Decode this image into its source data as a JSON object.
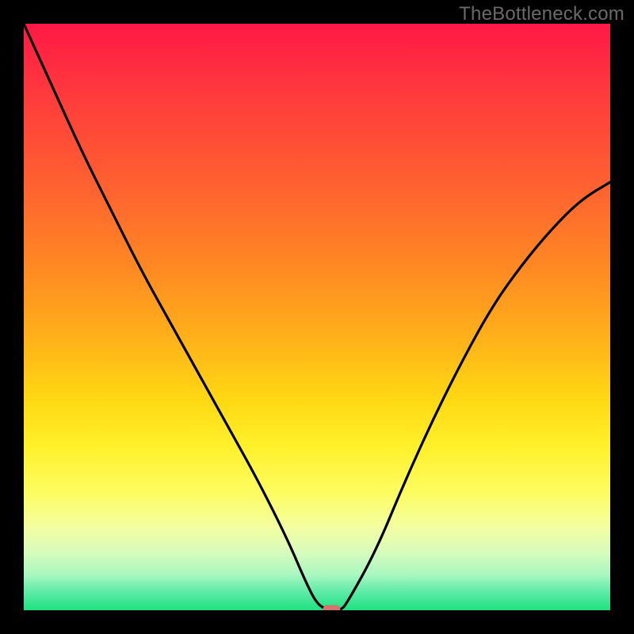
{
  "watermark": "TheBottleneck.com",
  "chart_data": {
    "type": "line",
    "title": "",
    "xlabel": "",
    "ylabel": "",
    "xlim": [
      0,
      100
    ],
    "ylim": [
      0,
      100
    ],
    "grid": false,
    "legend": false,
    "series": [
      {
        "name": "bottleneck-curve",
        "x": [
          0,
          5,
          10,
          15,
          20,
          25,
          30,
          35,
          40,
          45,
          48,
          50,
          52,
          54,
          55,
          60,
          65,
          70,
          75,
          80,
          85,
          90,
          95,
          100
        ],
        "values": [
          100,
          89,
          78,
          68,
          58,
          49,
          40,
          31,
          22,
          12,
          5,
          1,
          0,
          0,
          1,
          10,
          22,
          33,
          43,
          52,
          59,
          65,
          70,
          73
        ]
      }
    ],
    "marker": {
      "x": 52.5,
      "y": 0,
      "color": "#d4756b"
    },
    "background_gradient": {
      "direction": "top-to-bottom",
      "stops": [
        {
          "pos": 0,
          "color": "#ff1846"
        },
        {
          "pos": 12,
          "color": "#ff3a3d"
        },
        {
          "pos": 28,
          "color": "#ff6230"
        },
        {
          "pos": 42,
          "color": "#ff8a22"
        },
        {
          "pos": 54,
          "color": "#ffb219"
        },
        {
          "pos": 64,
          "color": "#ffd813"
        },
        {
          "pos": 72,
          "color": "#fff02a"
        },
        {
          "pos": 80,
          "color": "#fdfd61"
        },
        {
          "pos": 86,
          "color": "#f2fea2"
        },
        {
          "pos": 90,
          "color": "#d8fcbc"
        },
        {
          "pos": 94,
          "color": "#a8f7c0"
        },
        {
          "pos": 97,
          "color": "#5beaa6"
        },
        {
          "pos": 100,
          "color": "#1ee27f"
        }
      ]
    }
  }
}
